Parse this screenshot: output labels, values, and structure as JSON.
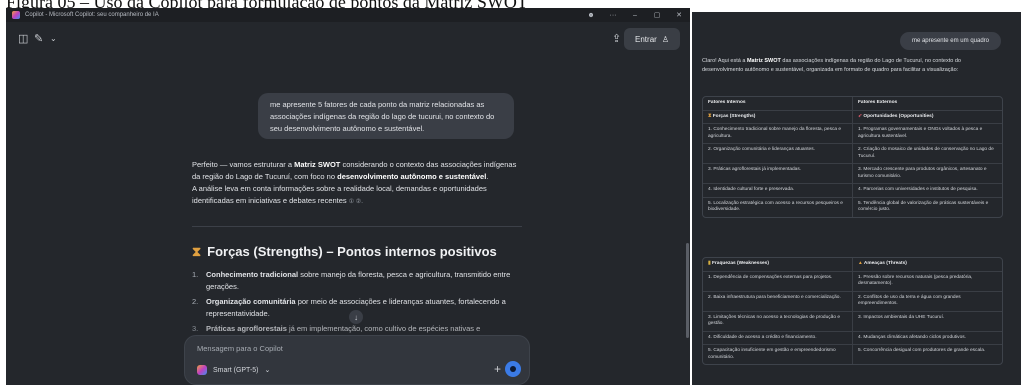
{
  "caption": "Figura 05 – Uso da Copilot para formulação de pontos da Matriz SWOT",
  "window": {
    "title": "Copilot - Microsoft Copilot: seu companheiro de IA",
    "controls": {
      "minimize": "–",
      "maximize": "▢",
      "close": "✕",
      "more": "···"
    }
  },
  "toolbar": {
    "entrar_label": "Entrar"
  },
  "conversation": {
    "user_message": "me apresente 5 fatores de cada ponto da matriz relacionadas as associações indígenas da região do lago de tucurui, no contexto do seu desenvolvimento autônomo e sustentável.",
    "reply": {
      "p1_a": "Perfeito — vamos estruturar a ",
      "p1_b": "Matriz SWOT",
      "p1_c": " considerando o contexto das associações indígenas da região do Lago de Tucuruí, com foco no ",
      "p1_d": "desenvolvimento autônomo e sustentável",
      "p1_e": ".",
      "p2": "A análise leva em conta informações sobre a realidade local, demandas e oportunidades identificadas em iniciativas e debates recentes",
      "refs": "① ②."
    },
    "section_title": "Forças (Strengths) – Pontos internos positivos",
    "items": [
      {
        "num": "1.",
        "bold": "Conhecimento tradicional",
        "text": " sobre manejo da floresta, pesca e agricultura, transmitido entre gerações."
      },
      {
        "num": "2.",
        "bold": "Organização comunitária",
        "text": " por meio de associações e lideranças atuantes, fortalecendo a representatividade."
      },
      {
        "num": "3.",
        "bold": "Práticas agroflorestais",
        "text": " já em implementação, como cultivo de espécies nativas e"
      }
    ]
  },
  "composer": {
    "placeholder": "Mensagem para o Copilot",
    "model": "Smart (GPT-5)"
  },
  "right_panel": {
    "user_message": "me apresente em um quadro",
    "intro_a": "Claro! Aqui está a ",
    "intro_b": "Matriz SWOT",
    "intro_c": " das associações indígenas da região do Lago de Tucuruí, no contexto do desenvolvimento autônomo e sustentável, organizada em formato de quadro para facilitar a visualização:",
    "table1": {
      "headers": [
        "Fatores Internos",
        "Fatores Externos"
      ],
      "subheaders": [
        "Forças (Strengths)",
        "Oportunidades (Opportunities)"
      ],
      "rows": [
        [
          "1. Conhecimento tradicional sobre manejo da floresta, pesca e agricultura.",
          "1. Programas governamentais e ONGs voltados à pesca e agricultura sustentável."
        ],
        [
          "2. Organização comunitária e lideranças atuantes.",
          "2. Criação do mosaico de unidades de conservação no Lago de Tucuruí."
        ],
        [
          "3. Práticas agroflorestais já implementadas.",
          "3. Mercado crescente para produtos orgânicos, artesanato e turismo comunitário."
        ],
        [
          "4. Identidade cultural forte e preservada.",
          "4. Parcerias com universidades e institutos de pesquisa."
        ],
        [
          "5. Localização estratégica com acesso a recursos pesqueiros e biodiversidade.",
          "5. Tendência global de valorização de práticas sustentáveis e comércio justo."
        ]
      ]
    },
    "table2": {
      "subheaders": [
        "Fraquezas (Weaknesses)",
        "Ameaças (Threats)"
      ],
      "rows": [
        [
          "1. Dependência de compensações externas para projetos.",
          "1. Pressão sobre recursos naturais (pesca predatória, desmatamento)."
        ],
        [
          "2. Baixa infraestrutura para beneficiamento e comercialização.",
          "2. Conflitos de uso da terra e água com grandes empreendimentos."
        ],
        [
          "3. Limitações técnicas no acesso a tecnologias de produção e gestão.",
          "3. Impactos ambientais da UHE Tucuruí."
        ],
        [
          "4. Dificuldade de acesso a crédito e financiamento.",
          "4. Mudanças climáticas afetando ciclos produtivos."
        ],
        [
          "5. Capacitação insuficiente em gestão e empreendedorismo comunitário.",
          "5. Concorrência desigual com produtores de grande escala."
        ]
      ]
    }
  }
}
